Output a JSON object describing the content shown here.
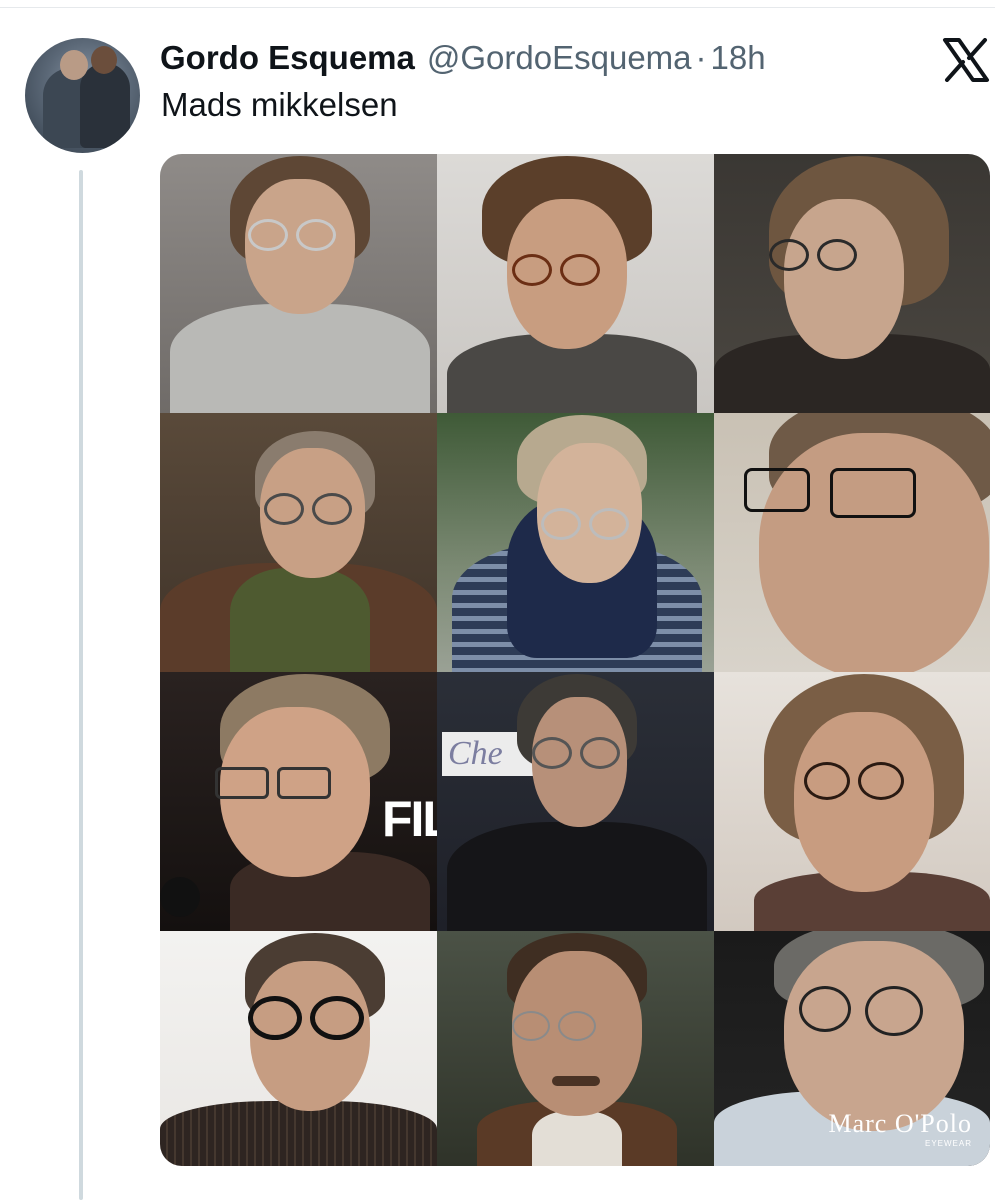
{
  "tweet": {
    "author_name": "Gordo Esquema",
    "author_handle": "@GordoEsquema",
    "separator": "·",
    "timestamp": "18h",
    "text": "Mads mikkelsen",
    "platform_icon": "x-logo-icon"
  },
  "media": {
    "grid_columns": 3,
    "grid_rows": 4,
    "photos": [
      {
        "name": "photo-grey-turtleneck",
        "text": ""
      },
      {
        "name": "photo-round-tortoise-glasses",
        "text": ""
      },
      {
        "name": "photo-dark-jacket",
        "text": ""
      },
      {
        "name": "photo-green-jacket-smiling",
        "text": ""
      },
      {
        "name": "photo-striped-hoodie-outdoors",
        "text": ""
      },
      {
        "name": "photo-closeup-black-glasses",
        "text": ""
      },
      {
        "name": "photo-event-microphone",
        "text": "FIL"
      },
      {
        "name": "photo-chef-sign",
        "text": "Che"
      },
      {
        "name": "photo-wavy-hair-glasses",
        "text": ""
      },
      {
        "name": "photo-pinstripe-suit",
        "text": ""
      },
      {
        "name": "photo-period-mustache",
        "text": ""
      },
      {
        "name": "photo-marc-opolo-ad",
        "text": "Marc O'Polo",
        "subtext": "EYEWEAR"
      }
    ]
  },
  "colors": {
    "text_primary": "#0f1419",
    "text_secondary": "#536471",
    "thread_line": "#cfd9de"
  }
}
